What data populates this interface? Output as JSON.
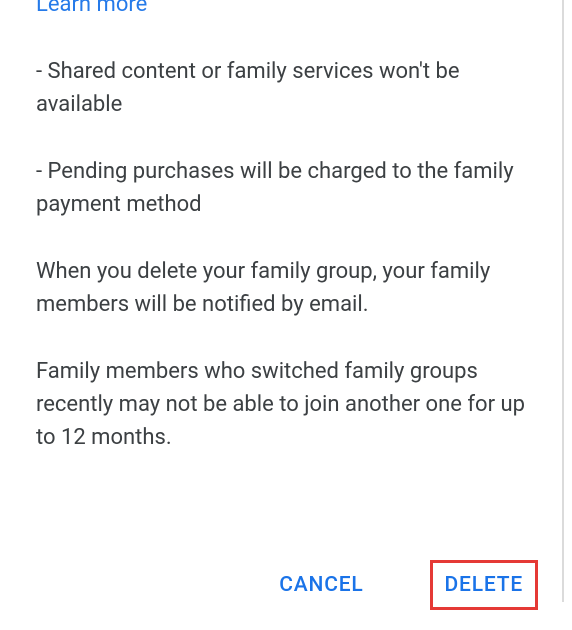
{
  "learnMore": "Learn more",
  "bullets": [
    "- Shared content or family services won't be available",
    "- Pending purchases will be charged to the family payment method"
  ],
  "paragraphs": [
    "When you delete your family group, your family members will be notified by email.",
    "Family members who switched family groups recently may not be able to join another one for up to 12 months."
  ],
  "actions": {
    "cancel": "CANCEL",
    "delete": "DELETE"
  }
}
